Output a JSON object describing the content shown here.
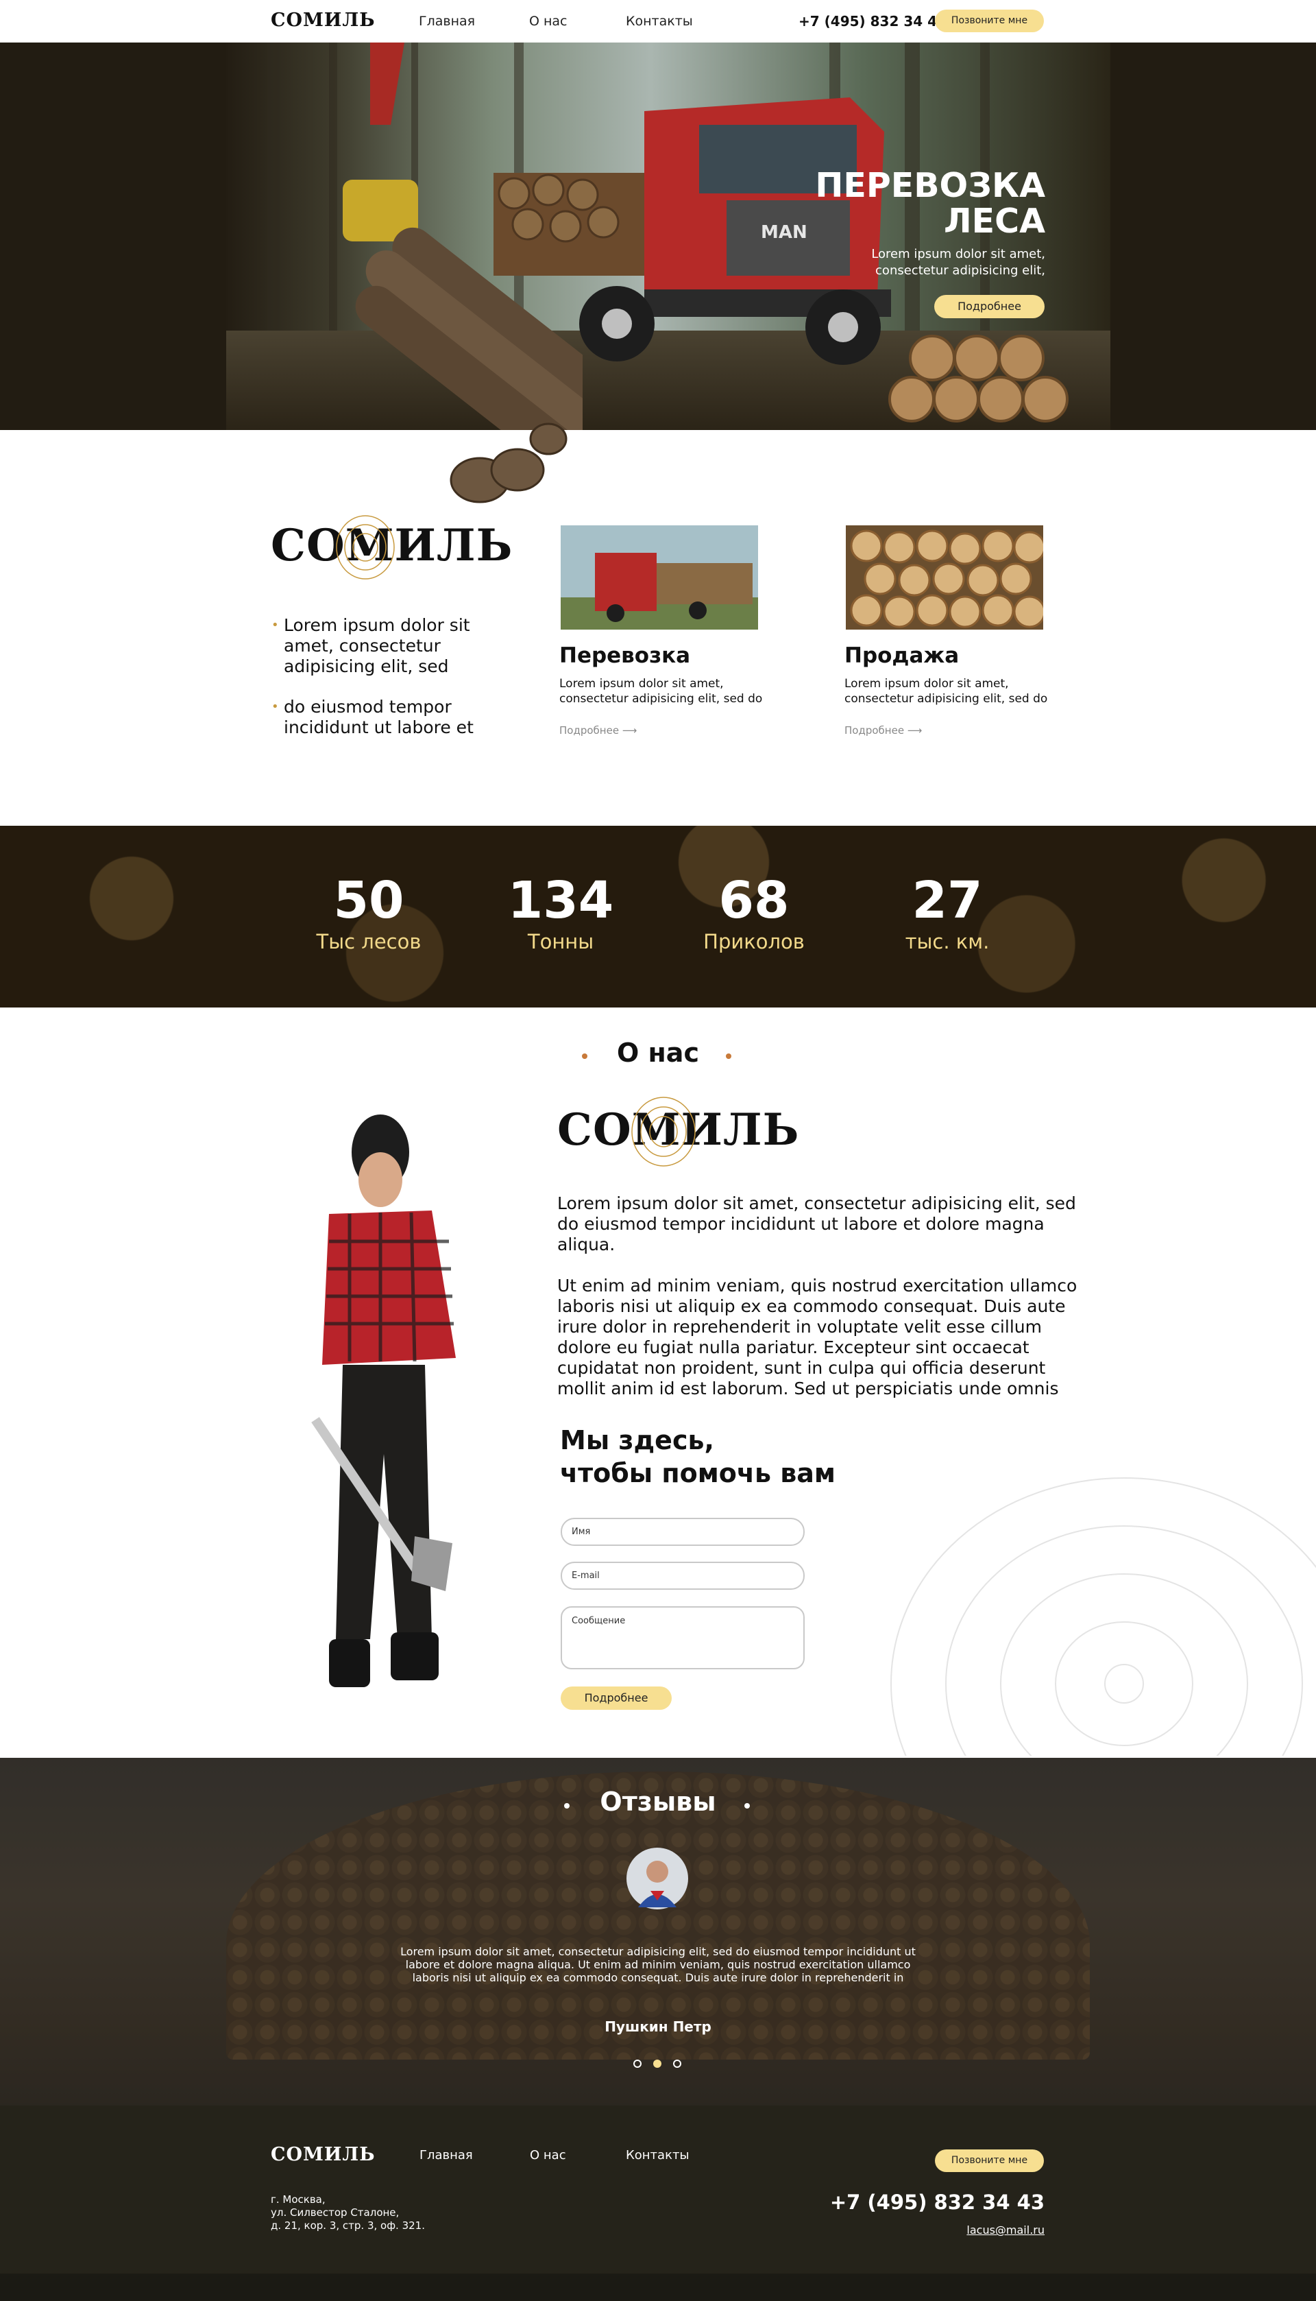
{
  "nav": {
    "logo": "СОМИЛЬ",
    "links": [
      "Главная",
      "О нас",
      "Контакты"
    ],
    "phone": "+7 (495) 832 34 43",
    "call_button": "Позвоните мне"
  },
  "hero": {
    "title_line1": "ПЕРЕВОЗКА",
    "title_line2": "ЛЕСА",
    "text_line1": "Lorem ipsum dolor sit amet,",
    "text_line2": "consectetur adipisicing elit,",
    "button": "Подробнее",
    "truck_brand": "MAN"
  },
  "services": {
    "logo": "СОМИЛЬ",
    "bullets": [
      [
        "Lorem ipsum dolor sit",
        "amet, consectetur",
        "adipisicing elit, sed"
      ],
      [
        "do eiusmod tempor",
        "incididunt ut labore et"
      ]
    ],
    "cards": [
      {
        "title": "Перевозка",
        "text1": "Lorem ipsum dolor sit amet,",
        "text2": "consectetur adipisicing elit, sed do",
        "more": "Подробнее ⟶"
      },
      {
        "title": "Продажа",
        "text1": "Lorem ipsum dolor sit amet,",
        "text2": "consectetur adipisicing elit, sed do",
        "more": "Подробнее ⟶"
      }
    ]
  },
  "stats": [
    {
      "value": "50",
      "label": "Тыс лесов"
    },
    {
      "value": "134",
      "label": "Тонны"
    },
    {
      "value": "68",
      "label": "Приколов"
    },
    {
      "value": "27",
      "label": "тыс. км."
    }
  ],
  "about": {
    "title": "О нас",
    "logo": "СОМИЛЬ",
    "para1": [
      "Lorem ipsum dolor sit amet, consectetur adipisicing elit, sed",
      "do eiusmod tempor incididunt ut labore et dolore magna",
      "aliqua."
    ],
    "para2": [
      "Ut enim ad minim veniam, quis nostrud exercitation ullamco",
      "laboris nisi ut aliquip ex ea commodo consequat. Duis aute",
      "irure dolor in reprehenderit in voluptate velit esse cillum",
      "dolore eu fugiat nulla pariatur. Excepteur sint occaecat",
      "cupidatat non proident, sunt in culpa qui officia deserunt",
      "mollit anim id est laborum. Sed ut perspiciatis unde omnis"
    ],
    "form_title1": "Мы здесь,",
    "form_title2": "чтобы помочь вам",
    "name_placeholder": "Имя",
    "email_placeholder": "E-mail",
    "message_placeholder": "Сообщение",
    "submit": "Подробнее"
  },
  "reviews": {
    "title": "Отзывы",
    "text": [
      "Lorem ipsum dolor sit amet, consectetur adipisicing elit, sed do eiusmod tempor incididunt ut",
      "labore et dolore magna aliqua. Ut enim ad minim veniam, quis nostrud exercitation ullamco",
      "laboris nisi ut aliquip ex ea commodo consequat. Duis aute irure dolor in reprehenderit in"
    ],
    "author": "Пушкин Петр",
    "active_dot": 2
  },
  "footer": {
    "logo": "СОМИЛЬ",
    "links": [
      "Главная",
      "О нас",
      "Контакты"
    ],
    "call_button": "Позвоните мне",
    "address": [
      "г. Москва,",
      "ул. Силвестор Сталоне,",
      "д. 21, кор. 3, стр. 3, оф. 321."
    ],
    "phone": "+7 (495) 832 34 43",
    "email": "lacus@mail.ru"
  },
  "colors": {
    "accent": "#f7df91",
    "gold": "#c89a3f",
    "dark": "#25231a"
  }
}
